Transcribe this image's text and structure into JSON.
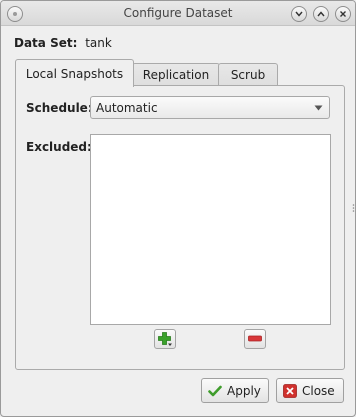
{
  "window": {
    "title": "Configure Dataset",
    "controls": [
      "minimize",
      "maximize",
      "close"
    ]
  },
  "dataset": {
    "label": "Data Set:",
    "value": "tank"
  },
  "tabs": [
    {
      "label": "Local Snapshots",
      "active": true
    },
    {
      "label": "Replication",
      "active": false
    },
    {
      "label": "Scrub",
      "active": false
    }
  ],
  "schedule": {
    "label": "Schedule:",
    "value": "Automatic"
  },
  "excluded": {
    "label": "Excluded:",
    "items": []
  },
  "list_actions": {
    "add_icon": "add-icon",
    "remove_icon": "remove-icon"
  },
  "footer": {
    "apply_label": "Apply",
    "close_label": "Close"
  },
  "colors": {
    "add_green": "#3aa12a",
    "remove_red": "#d9383a",
    "apply_green": "#3f9d2c",
    "close_red": "#d0312d"
  }
}
